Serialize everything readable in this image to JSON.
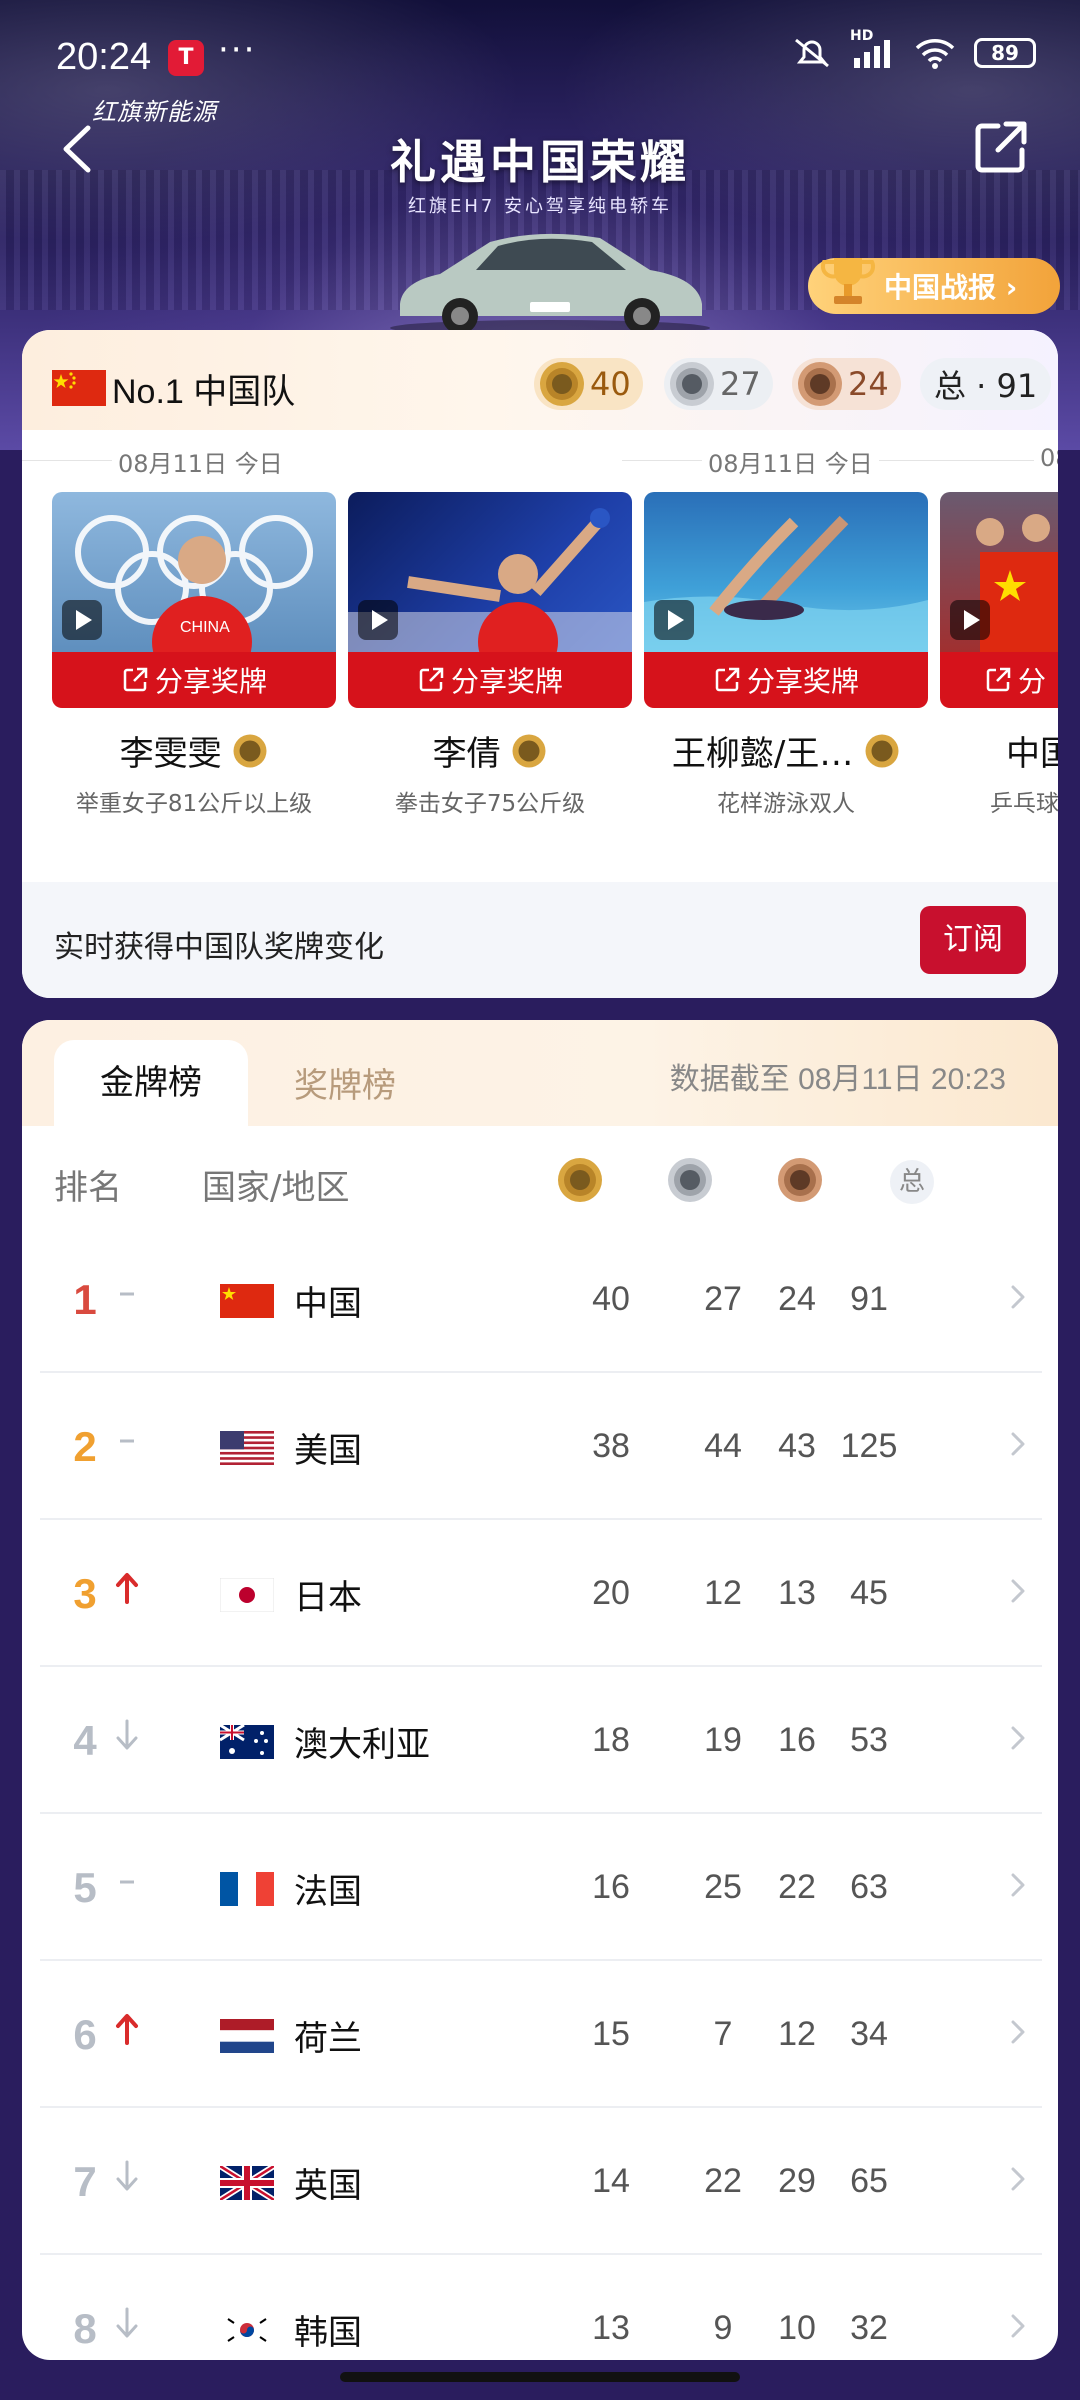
{
  "status_bar": {
    "time": "20:24",
    "app_badge": "T",
    "more": "···",
    "hd_label": "HD",
    "battery": "89"
  },
  "header": {
    "brand": "红旗新能源",
    "title": "礼遇中国荣耀",
    "subtitle": "红旗EH7  安心驾享纯电轿车",
    "report_button": "中国战报 ›",
    "icons": {
      "back": "back-arrow-icon",
      "share": "share-icon",
      "trophy": "trophy-icon",
      "car": "car-illustration"
    }
  },
  "summary": {
    "team": "No.1 中国队",
    "gold": "40",
    "silver": "27",
    "bronze": "24",
    "total": "总 · 91"
  },
  "date_labels": [
    "08月11日 今日",
    "08月11日 今日",
    "08"
  ],
  "athletes": [
    {
      "share_label": "分享奖牌",
      "name": "李雯雯",
      "event": "举重女子81公斤以上级"
    },
    {
      "share_label": "分享奖牌",
      "name": "李倩",
      "event": "拳击女子75公斤级"
    },
    {
      "share_label": "分享奖牌",
      "name": "王柳懿/王…",
      "event": "花样游泳双人"
    },
    {
      "share_label": "分",
      "name": "中国",
      "event": "乒乓球"
    }
  ],
  "subscribe": {
    "text": "实时获得中国队奖牌变化",
    "button": "订阅"
  },
  "table": {
    "tabs": [
      "金牌榜",
      "奖牌榜"
    ],
    "data_time": "数据截至 08月11日 20:23",
    "headers": {
      "rank": "排名",
      "country": "国家/地区",
      "total": "总"
    },
    "colors": {
      "rank1": "#d94a3f",
      "rank2": "#f0a030",
      "rank3": "#f0a030",
      "rank_other": "#b7bdc6",
      "up": "#d92b2b",
      "down": "#b7bdc6",
      "flat": "#b7bdc6"
    },
    "rows": [
      {
        "rank": "1",
        "trend": "flat",
        "flag": "cn",
        "name": "中国",
        "gold": "40",
        "silver": "27",
        "bronze": "24",
        "total": "91"
      },
      {
        "rank": "2",
        "trend": "flat",
        "flag": "us",
        "name": "美国",
        "gold": "38",
        "silver": "44",
        "bronze": "43",
        "total": "125"
      },
      {
        "rank": "3",
        "trend": "up",
        "flag": "jp",
        "name": "日本",
        "gold": "20",
        "silver": "12",
        "bronze": "13",
        "total": "45"
      },
      {
        "rank": "4",
        "trend": "down",
        "flag": "au",
        "name": "澳大利亚",
        "gold": "18",
        "silver": "19",
        "bronze": "16",
        "total": "53"
      },
      {
        "rank": "5",
        "trend": "flat",
        "flag": "fr",
        "name": "法国",
        "gold": "16",
        "silver": "25",
        "bronze": "22",
        "total": "63"
      },
      {
        "rank": "6",
        "trend": "up",
        "flag": "nl",
        "name": "荷兰",
        "gold": "15",
        "silver": "7",
        "bronze": "12",
        "total": "34"
      },
      {
        "rank": "7",
        "trend": "down",
        "flag": "gb",
        "name": "英国",
        "gold": "14",
        "silver": "22",
        "bronze": "29",
        "total": "65"
      },
      {
        "rank": "8",
        "trend": "down",
        "flag": "kr",
        "name": "韩国",
        "gold": "13",
        "silver": "9",
        "bronze": "10",
        "total": "32"
      }
    ]
  }
}
